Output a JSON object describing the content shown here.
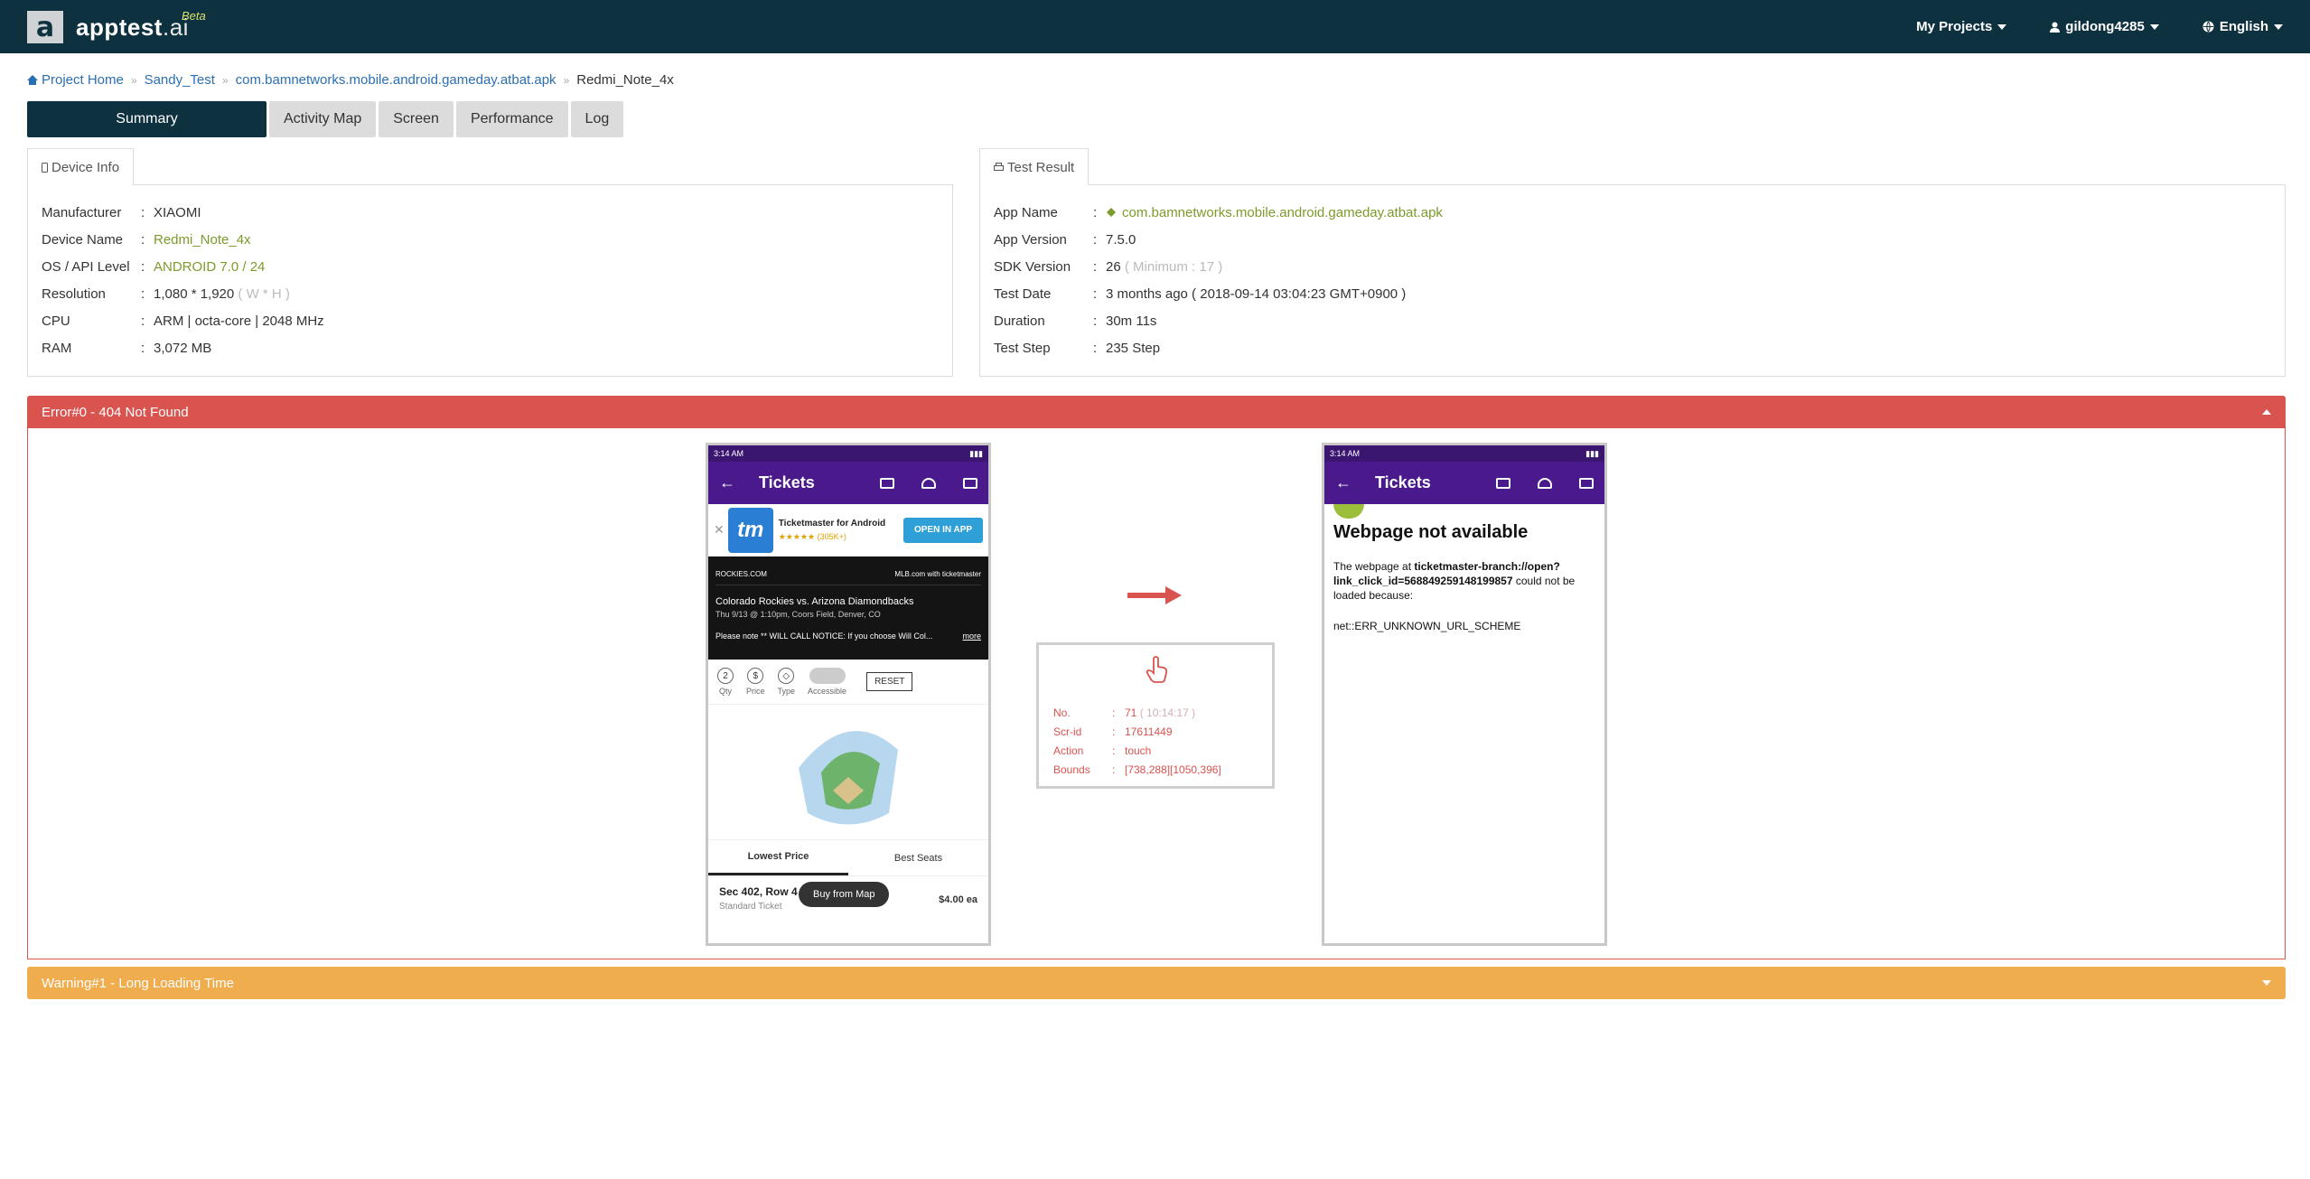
{
  "brand": {
    "logo_letter": "a",
    "name_main": "apptest",
    "name_suffix": ".ai",
    "badge": "Beta"
  },
  "nav": {
    "my_projects": "My Projects",
    "user": "gildong4285",
    "language": "English"
  },
  "breadcrumb": {
    "home": "Project Home",
    "project": "Sandy_Test",
    "apk": "com.bamnetworks.mobile.android.gameday.atbat.apk",
    "device": "Redmi_Note_4x"
  },
  "tabs": [
    "Summary",
    "Activity Map",
    "Screen",
    "Performance",
    "Log"
  ],
  "device_info": {
    "title": "Device Info",
    "rows": [
      {
        "label": "Manufacturer",
        "value": "XIAOMI",
        "extra": ""
      },
      {
        "label": "Device Name",
        "value": "Redmi_Note_4x",
        "extra": ""
      },
      {
        "label": "OS / API Level",
        "value": "ANDROID 7.0 / 24",
        "extra": ""
      },
      {
        "label": "Resolution",
        "value": "1,080 * 1,920",
        "extra": "( W * H )"
      },
      {
        "label": "CPU",
        "value": "ARM | octa-core | 2048 MHz",
        "extra": ""
      },
      {
        "label": "RAM",
        "value": "3,072 MB",
        "extra": ""
      }
    ]
  },
  "test_result": {
    "title": "Test Result",
    "rows": [
      {
        "label": "App Name",
        "value": "com.bamnetworks.mobile.android.gameday.atbat.apk",
        "extra": ""
      },
      {
        "label": "App Version",
        "value": "7.5.0",
        "extra": ""
      },
      {
        "label": "SDK Version",
        "value": "26",
        "extra": "( Minimum : 17 )"
      },
      {
        "label": "Test Date",
        "value": "3 months ago ( 2018-09-14 03:04:23 GMT+0900 )",
        "extra": ""
      },
      {
        "label": "Duration",
        "value": "30m 11s",
        "extra": ""
      },
      {
        "label": "Test Step",
        "value": "235 Step",
        "extra": ""
      }
    ]
  },
  "error": {
    "title": "Error#0 - 404 Not Found"
  },
  "warning": {
    "title": "Warning#1 - Long Loading Time"
  },
  "action": {
    "rows": [
      {
        "label": "No.",
        "value": "71",
        "extra": "( 10:14:17 )"
      },
      {
        "label": "Scr-id",
        "value": "17611449",
        "extra": ""
      },
      {
        "label": "Action",
        "value": "touch",
        "extra": ""
      },
      {
        "label": "Bounds",
        "value": "[738,288][1050,396]",
        "extra": ""
      }
    ]
  },
  "before_screen": {
    "status_time": "3:14 AM",
    "bar_title": "Tickets",
    "tm_name": "Ticketmaster for Android",
    "tm_rating": "★★★★★ (305K+)",
    "tm_open": "OPEN IN APP",
    "tm_logo": "tm",
    "logo_left": "ROCKIES.COM",
    "logo_right": "MLB.com with ticketmaster",
    "event_title": "Colorado Rockies vs. Arizona Diamondbacks",
    "event_sub": "Thu 9/13 @ 1:10pm, Coors Field, Denver, CO",
    "event_note": "Please note ** WILL CALL NOTICE: If you choose Will Col...",
    "event_more": "more",
    "filters": [
      {
        "glyph": "2",
        "label": "Qty"
      },
      {
        "glyph": "$",
        "label": "Price"
      },
      {
        "glyph": "◇",
        "label": "Type"
      }
    ],
    "accessible": "Accessible",
    "reset": "RESET",
    "sort_low": "Lowest Price",
    "sort_best": "Best Seats",
    "listing_sec": "Sec 402, Row 4",
    "listing_std": "Standard Ticket",
    "listing_price": "$4.00 ea",
    "buy_map": "Buy from Map"
  },
  "after_screen": {
    "status_time": "3:14 AM",
    "bar_title": "Tickets",
    "heading": "Webpage not available",
    "msg_pre": "The webpage at ",
    "msg_url": "ticketmaster-branch://open?link_click_id=568849259148199857",
    "msg_post": " could not be loaded because:",
    "err_code": "net::ERR_UNKNOWN_URL_SCHEME"
  },
  "colors": {
    "navbar": "#0e3140",
    "error": "#d9534f",
    "warning": "#f0ad4e",
    "link": "#2b6fb3",
    "green": "#7b9b2a",
    "phone_bar": "#4a1a8c"
  }
}
